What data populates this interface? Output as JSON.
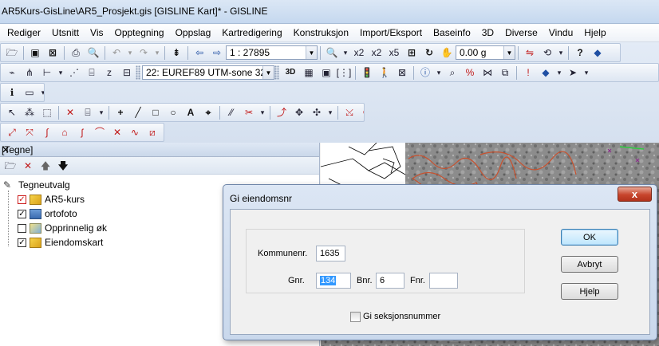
{
  "window": {
    "title": "AR5Kurs-GisLine\\AR5_Prosjekt.gis [GISLINE Kart]* - GISLINE"
  },
  "menubar": {
    "items": [
      "Rediger",
      "Utsnitt",
      "Vis",
      "Opptegning",
      "Oppslag",
      "Kartredigering",
      "Konstruksjon",
      "Import/Eksport",
      "Baseinfo",
      "3D",
      "Diverse",
      "Vindu",
      "Hjelp"
    ]
  },
  "toolbar": {
    "scale_value": "1 : 27895",
    "angle_value": "0.00 g",
    "coord_system": "22: EUREF89 UTM-sone 32",
    "label_3d": "3D"
  },
  "panel": {
    "title": "[Tegne]",
    "tree_root": "Tegneutvalg",
    "layers": [
      {
        "label": "AR5-kurs",
        "checked": true
      },
      {
        "label": "ortofoto",
        "checked": true
      },
      {
        "label": "Opprinnelig øk",
        "checked": false
      },
      {
        "label": "Eiendomskart",
        "checked": true
      }
    ]
  },
  "dialog": {
    "title": "Gi eiendomsnr",
    "kommunenr_label": "Kommunenr.",
    "kommunenr_value": "1635",
    "gnr_label": "Gnr.",
    "gnr_value": "134",
    "bnr_label": "Bnr.",
    "bnr_value": "6",
    "fnr_label": "Fnr.",
    "fnr_value": "",
    "seksjon_label": "Gi seksjonsnummer",
    "ok_label": "OK",
    "cancel_label": "Avbryt",
    "help_label": "Hjelp",
    "close_glyph": "x"
  },
  "colors": {
    "titlebar": "#c5d8ef",
    "dialog_close": "#c7452c",
    "map_outline": "#c8512e",
    "selection": "#3399ff"
  }
}
